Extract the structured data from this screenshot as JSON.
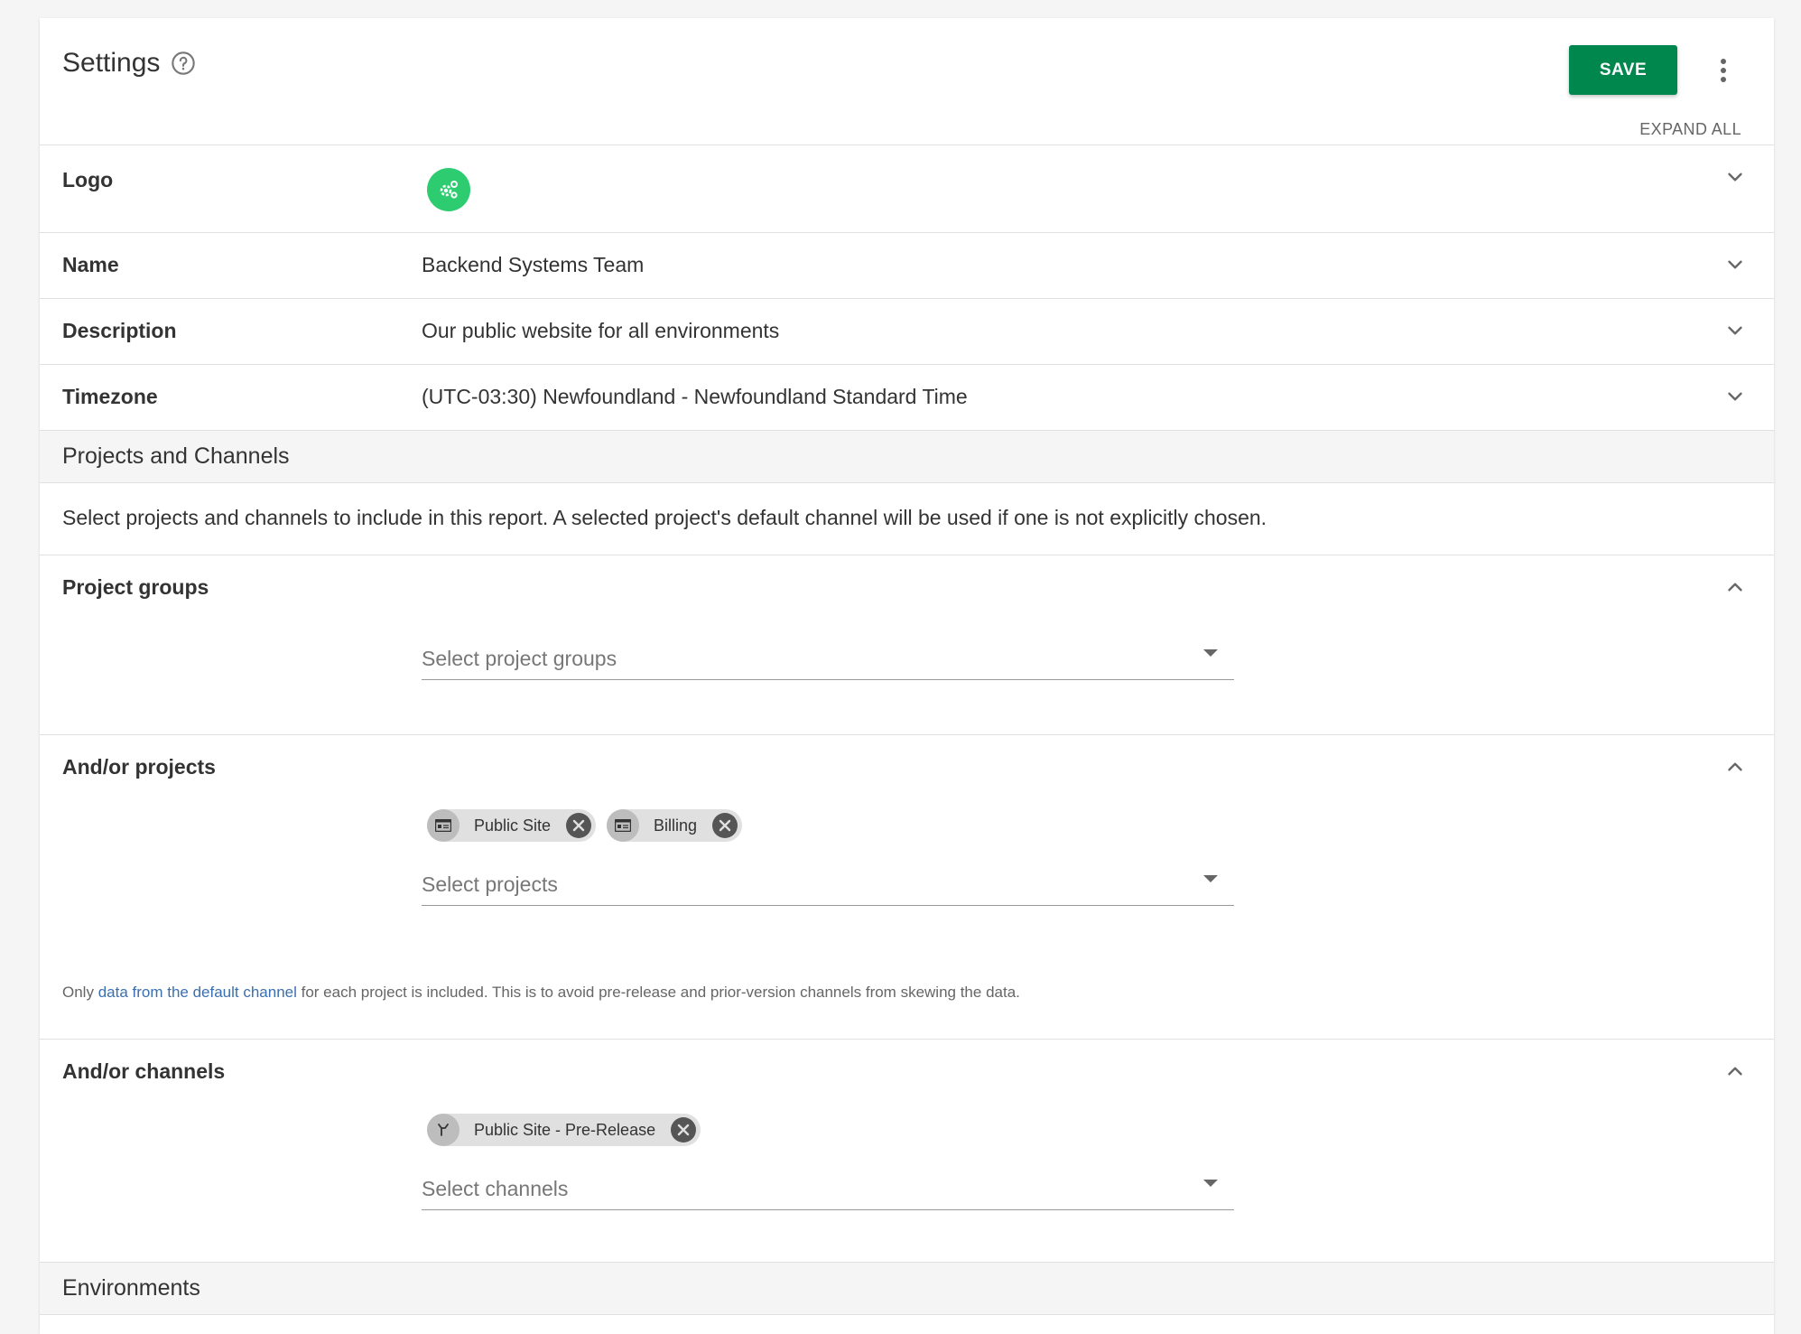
{
  "header": {
    "title": "Settings",
    "save_label": "SAVE",
    "expand_all_label": "EXPAND ALL"
  },
  "rows": {
    "logo": {
      "label": "Logo"
    },
    "name": {
      "label": "Name",
      "value": "Backend Systems Team"
    },
    "description": {
      "label": "Description",
      "value": "Our public website for all environments"
    },
    "timezone": {
      "label": "Timezone",
      "value": "(UTC-03:30) Newfoundland - Newfoundland Standard Time"
    }
  },
  "projects_channels": {
    "title": "Projects and Channels",
    "description": "Select projects and channels to include in this report. A selected project's default channel will be used if one is not explicitly chosen.",
    "project_groups": {
      "label": "Project groups",
      "placeholder": "Select project groups"
    },
    "projects": {
      "label": "And/or projects",
      "chips": [
        "Public Site",
        "Billing"
      ],
      "placeholder": "Select projects",
      "note_prefix": "Only ",
      "note_link": "data from the default channel",
      "note_suffix": " for each project is included. This is to avoid pre-release and prior-version channels from skewing the data."
    },
    "channels": {
      "label": "And/or channels",
      "chips": [
        "Public Site - Pre-Release"
      ],
      "placeholder": "Select channels"
    }
  },
  "environments": {
    "title": "Environments"
  },
  "colors": {
    "accent": "#00874d",
    "logo": "#2ecc71",
    "link": "#3a6fb0"
  }
}
